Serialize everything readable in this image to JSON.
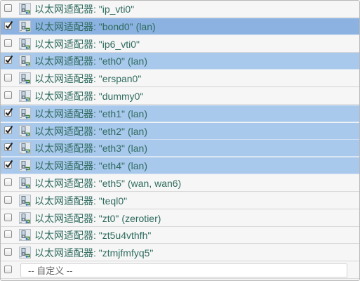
{
  "interfaces": [
    {
      "prefix": "以太网适配器:",
      "name": "\"ip_vti0\"",
      "zones": "",
      "checked": false,
      "focused": false
    },
    {
      "prefix": "以太网适配器:",
      "name": "\"bond0\"",
      "zones": "(lan)",
      "checked": true,
      "focused": true
    },
    {
      "prefix": "以太网适配器:",
      "name": "\"ip6_vti0\"",
      "zones": "",
      "checked": false,
      "focused": false
    },
    {
      "prefix": "以太网适配器:",
      "name": "\"eth0\"",
      "zones": "(lan)",
      "checked": true,
      "focused": false
    },
    {
      "prefix": "以太网适配器:",
      "name": "\"erspan0\"",
      "zones": "",
      "checked": false,
      "focused": false
    },
    {
      "prefix": "以太网适配器:",
      "name": "\"dummy0\"",
      "zones": "",
      "checked": false,
      "focused": false
    },
    {
      "prefix": "以太网适配器:",
      "name": "\"eth1\"",
      "zones": "(lan)",
      "checked": true,
      "focused": false
    },
    {
      "prefix": "以太网适配器:",
      "name": "\"eth2\"",
      "zones": "(lan)",
      "checked": true,
      "focused": false
    },
    {
      "prefix": "以太网适配器:",
      "name": "\"eth3\"",
      "zones": "(lan)",
      "checked": true,
      "focused": false
    },
    {
      "prefix": "以太网适配器:",
      "name": "\"eth4\"",
      "zones": "(lan)",
      "checked": true,
      "focused": false
    },
    {
      "prefix": "以太网适配器:",
      "name": "\"eth5\"",
      "zones": "(wan, wan6)",
      "checked": false,
      "focused": false
    },
    {
      "prefix": "以太网适配器:",
      "name": "\"teql0\"",
      "zones": "",
      "checked": false,
      "focused": false
    },
    {
      "prefix": "以太网适配器:",
      "name": "\"zt0\"",
      "zones": "(zerotier)",
      "checked": false,
      "focused": false
    },
    {
      "prefix": "以太网适配器:",
      "name": "\"zt5u4vthfh\"",
      "zones": "",
      "checked": false,
      "focused": false
    },
    {
      "prefix": "以太网适配器:",
      "name": "\"ztmjfmfyq5\"",
      "zones": "",
      "checked": false,
      "focused": false
    }
  ],
  "custom": {
    "placeholder": "-- 自定义 --",
    "checked": false
  },
  "icon": "ethernet-adapter-icon",
  "colors": {
    "checked_row": "#a8c8ec",
    "focused_row": "#8bb2e0",
    "label_text": "#2f6b5e"
  }
}
